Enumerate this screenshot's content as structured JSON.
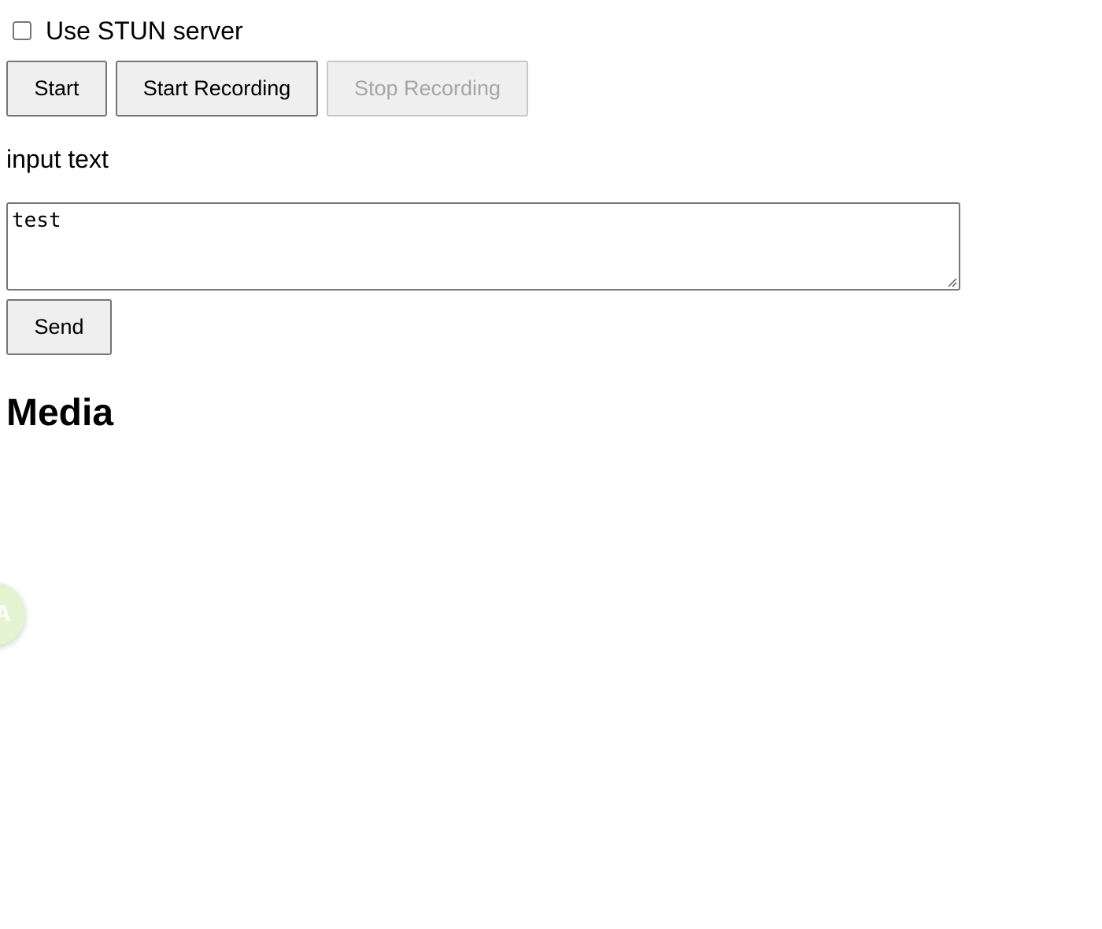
{
  "stun": {
    "label": "Use STUN server",
    "checked": false
  },
  "controls": {
    "start_label": "Start",
    "start_recording_label": "Start Recording",
    "stop_recording_label": "Stop Recording",
    "stop_recording_disabled": true
  },
  "text_input": {
    "label": "input text",
    "value": "test"
  },
  "send_label": "Send",
  "media": {
    "heading": "Media"
  },
  "floating_badge": {
    "text": "A"
  }
}
